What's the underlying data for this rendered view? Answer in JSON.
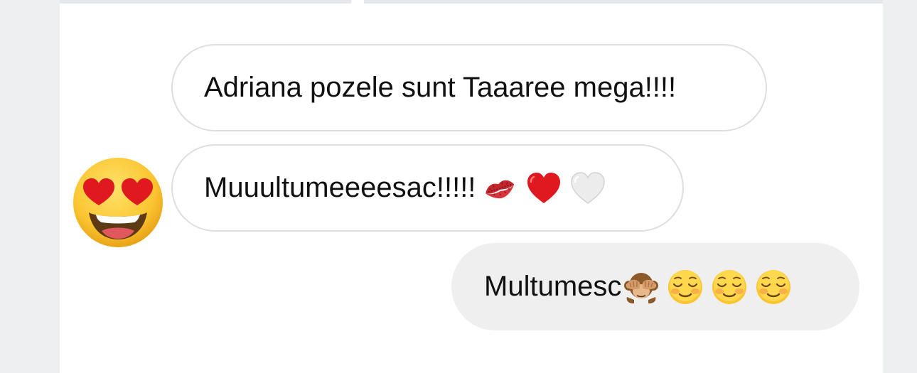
{
  "messages": [
    {
      "direction": "incoming",
      "text": "Adriana pozele sunt Taaaree mega!!!!",
      "emojis": []
    },
    {
      "direction": "incoming",
      "text": "Muuultumeeeesac!!!!!",
      "emojis": [
        "kiss-mark-icon",
        "red-heart-icon",
        "white-heart-icon"
      ]
    },
    {
      "direction": "outgoing",
      "text": "Multumesc",
      "emojis": [
        "see-no-evil-monkey-icon",
        "smiling-face-icon",
        "smiling-face-icon",
        "smiling-face-icon"
      ]
    }
  ],
  "reaction": {
    "emoji": "heart-eyes-face-icon"
  },
  "colors": {
    "incoming_bubble": "#ffffff",
    "incoming_border": "#dedede",
    "outgoing_bubble": "#efefef",
    "background": "#eeeff1",
    "text": "#111111"
  }
}
